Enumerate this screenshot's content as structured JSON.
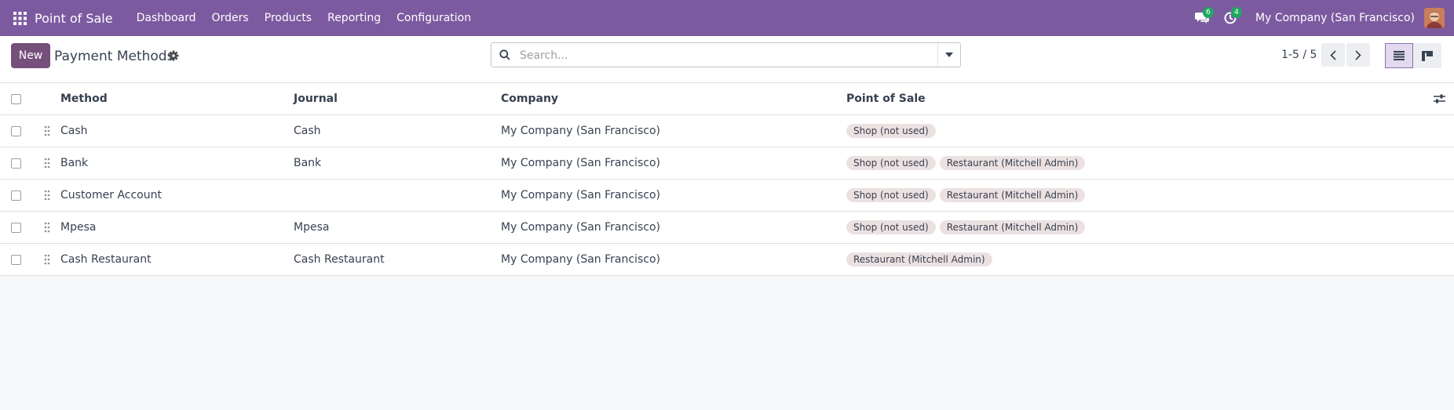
{
  "navbar": {
    "app_name": "Point of Sale",
    "menu": [
      "Dashboard",
      "Orders",
      "Products",
      "Reporting",
      "Configuration"
    ],
    "messages_count": "6",
    "activities_count": "4",
    "company": "My Company (San Francisco)"
  },
  "control_panel": {
    "new_label": "New",
    "title": "Payment Methods",
    "search_placeholder": "Search...",
    "pager": "1-5 / 5"
  },
  "list": {
    "columns": [
      "Method",
      "Journal",
      "Company",
      "Point of Sale"
    ],
    "rows": [
      {
        "method": "Cash",
        "journal": "Cash",
        "company": "My Company (San Francisco)",
        "pos": [
          "Shop (not used)"
        ]
      },
      {
        "method": "Bank",
        "journal": "Bank",
        "company": "My Company (San Francisco)",
        "pos": [
          "Shop (not used)",
          "Restaurant (Mitchell Admin)"
        ]
      },
      {
        "method": "Customer Account",
        "journal": "",
        "company": "My Company (San Francisco)",
        "pos": [
          "Shop (not used)",
          "Restaurant (Mitchell Admin)"
        ]
      },
      {
        "method": "Mpesa",
        "journal": "Mpesa",
        "company": "My Company (San Francisco)",
        "pos": [
          "Shop (not used)",
          "Restaurant (Mitchell Admin)"
        ]
      },
      {
        "method": "Cash Restaurant",
        "journal": "Cash Restaurant",
        "company": "My Company (San Francisco)",
        "pos": [
          "Restaurant (Mitchell Admin)"
        ]
      }
    ]
  },
  "colors": {
    "navbar": "#7c5aa0",
    "primary_button": "#75507b",
    "badge": "#1ea85f",
    "tag": "#ece1e1"
  },
  "icons": [
    "apps-grid-icon",
    "chat-icon",
    "clock-icon",
    "gear-icon",
    "search-icon",
    "caret-down-icon",
    "chevron-left-icon",
    "chevron-right-icon",
    "list-view-icon",
    "kanban-view-icon",
    "drag-handle-icon",
    "column-settings-icon"
  ]
}
